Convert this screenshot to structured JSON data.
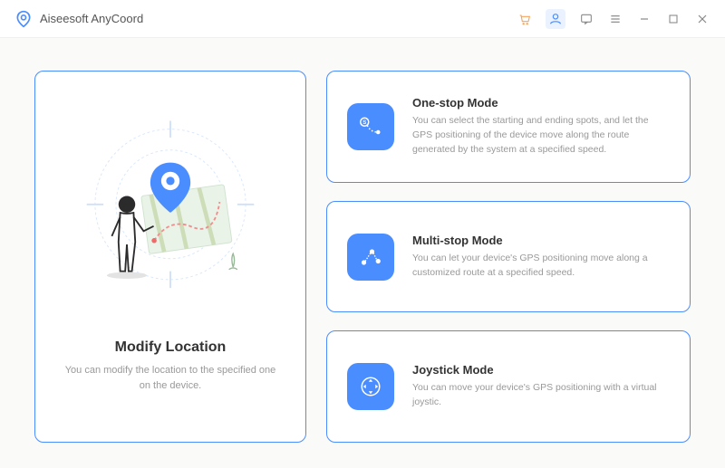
{
  "app": {
    "title": "Aiseesoft AnyCoord"
  },
  "left": {
    "title": "Modify Location",
    "description": "You can modify the location to the specified one on the device."
  },
  "modes": [
    {
      "icon": "onestop-icon",
      "title": "One-stop Mode",
      "description": "You can select the starting and ending spots, and let the GPS positioning of the device move along the route generated by the system at a specified speed."
    },
    {
      "icon": "multistop-icon",
      "title": "Multi-stop Mode",
      "description": "You can let your device's GPS positioning move along a customized route at a specified speed."
    },
    {
      "icon": "joystick-icon",
      "title": "Joystick Mode",
      "description": "You can move your device's GPS positioning with a virtual joystic."
    }
  ]
}
